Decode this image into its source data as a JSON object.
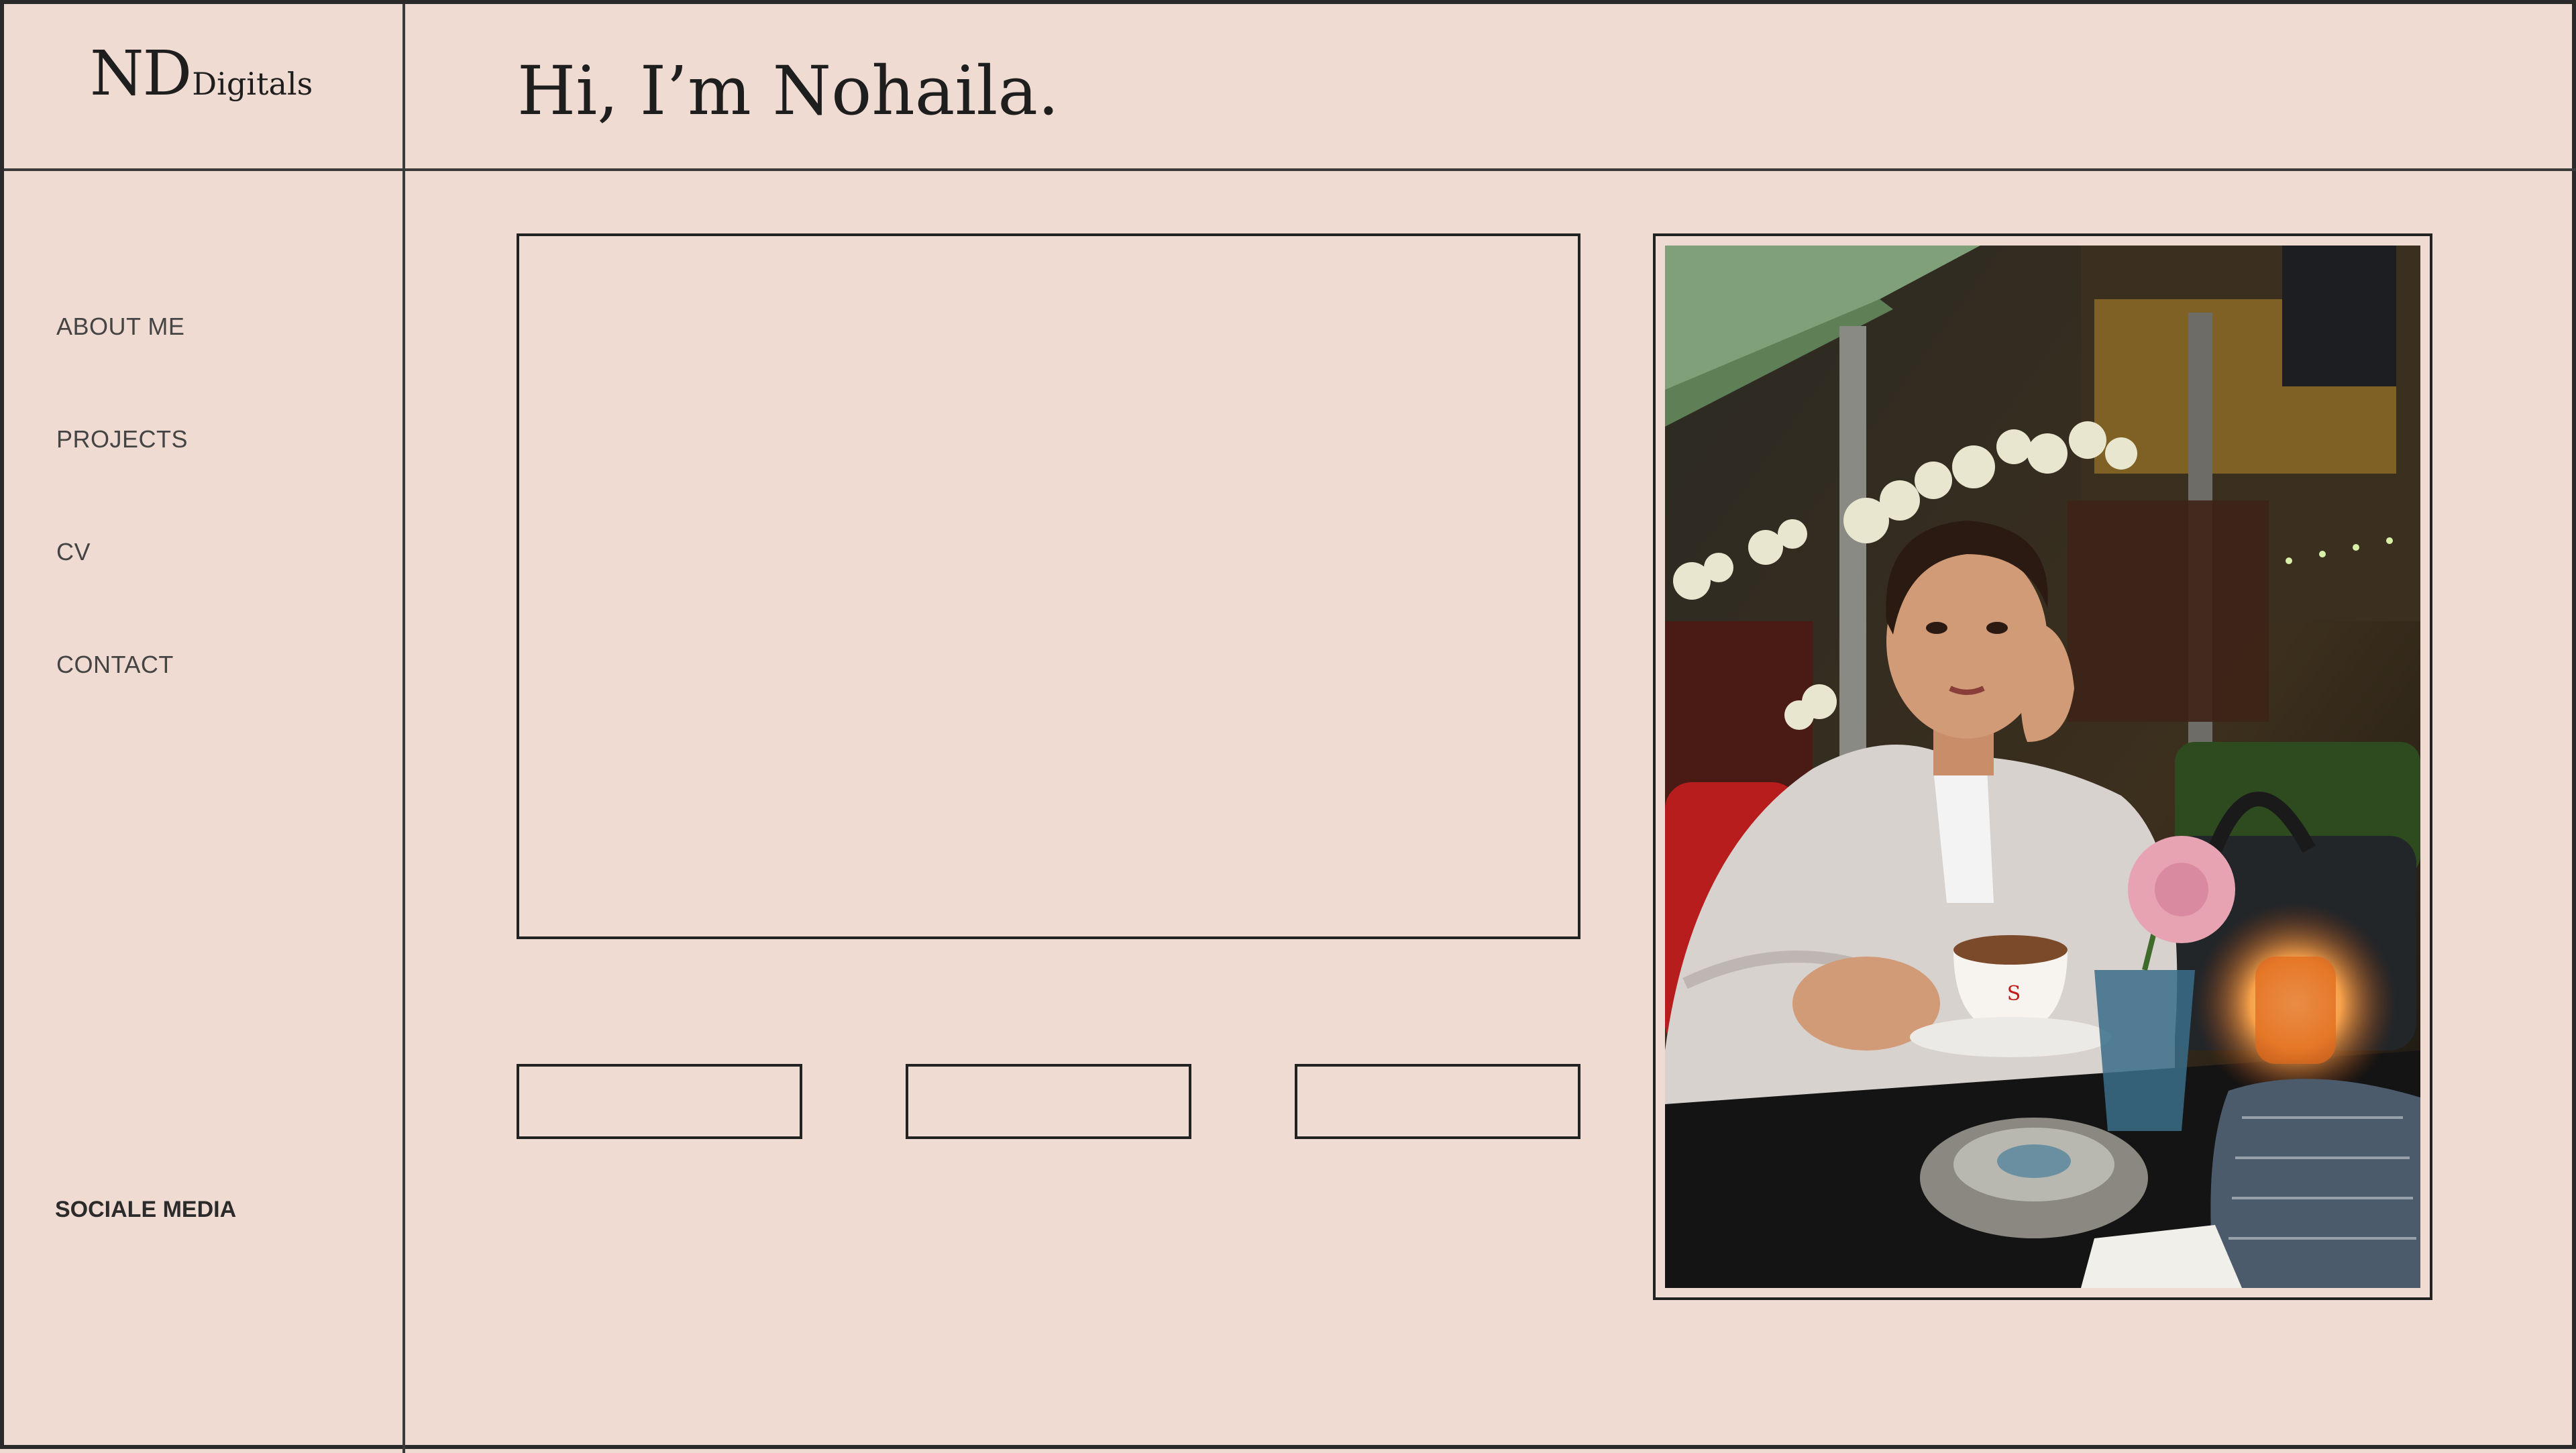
{
  "brand": {
    "logo_main": "ND",
    "logo_sub": "Digitals"
  },
  "header": {
    "greeting": "Hi, I’m Nohaila."
  },
  "sidebar": {
    "items": [
      {
        "label": "ABOUT ME"
      },
      {
        "label": "PROJECTS"
      },
      {
        "label": "CV"
      },
      {
        "label": "CONTACT"
      }
    ],
    "social_label": "SOCIALE MEDIA"
  },
  "main": {
    "buttons": [
      {
        "label": ""
      },
      {
        "label": ""
      },
      {
        "label": ""
      }
    ],
    "photo_alt": "Portrait photo"
  },
  "colors": {
    "background": "#efdbd1",
    "lines": "#2a2a2a",
    "text": "#1e1e1e"
  }
}
